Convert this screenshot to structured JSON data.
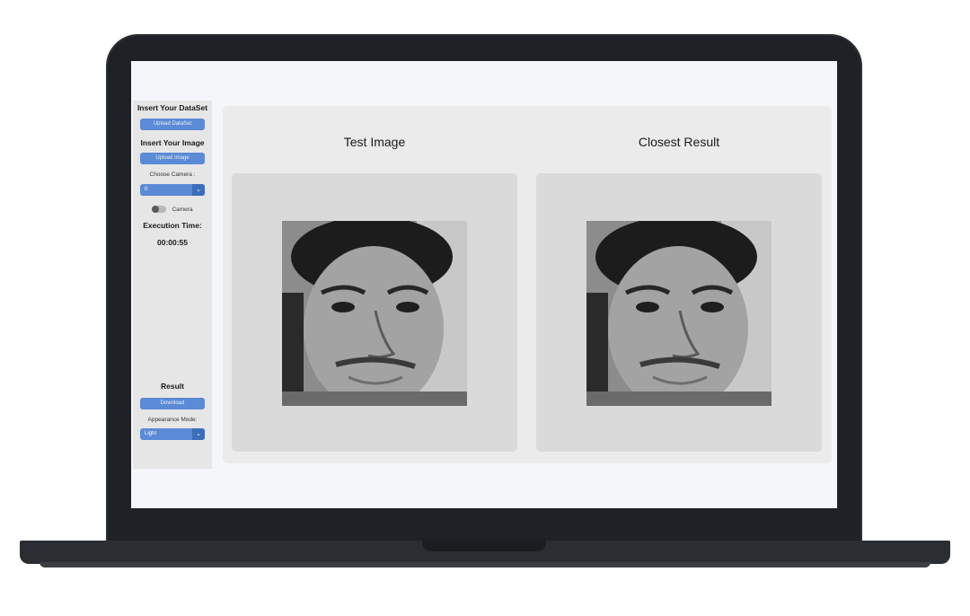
{
  "sidebar": {
    "dataset_heading": "Insert Your DataSet",
    "upload_dataset_label": "Upload DataSet",
    "image_heading": "Insert Your Image",
    "upload_image_label": "Upload Image",
    "camera_label": "Choose Camera :",
    "camera_value": "0",
    "camera_toggle_label": "Camera",
    "camera_toggle_on": false,
    "execution_label": "Execution Time:",
    "execution_value": "00:00:55",
    "result_heading": "Result",
    "download_label": "Download",
    "appearance_label": "Appearance Mode:",
    "appearance_value": "Light"
  },
  "main": {
    "test_title": "Test Image",
    "result_title": "Closest Result"
  },
  "colors": {
    "accent": "#5b8ad6",
    "accent_dark": "#3c6db8",
    "panel": "#dadada",
    "background": "#ebebeb"
  },
  "icons": {
    "dropdown": "chevron-down-icon",
    "toggle": "toggle-switch-icon"
  }
}
